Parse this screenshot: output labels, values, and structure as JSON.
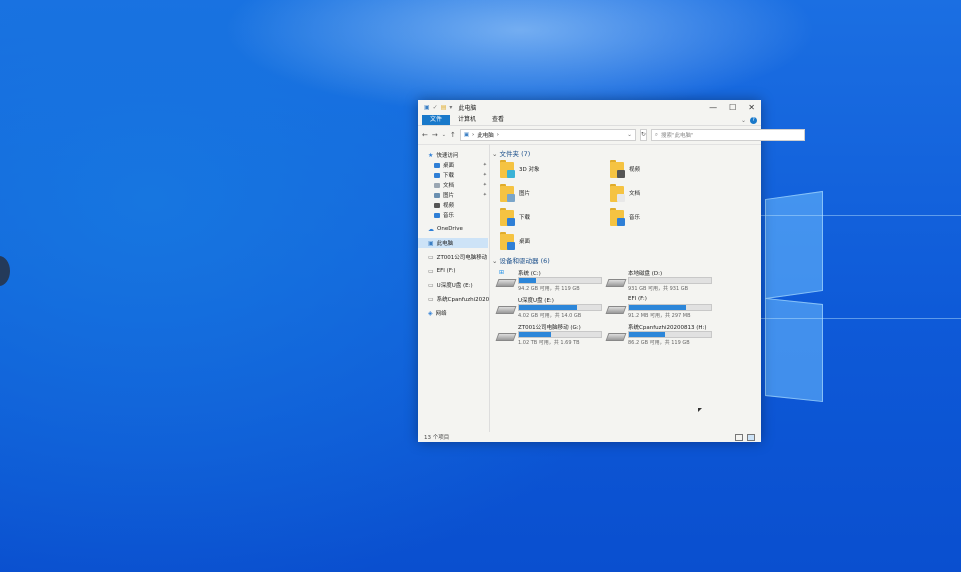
{
  "window": {
    "title": "此电脑",
    "controls": {
      "minimize": "—",
      "maximize": "☐",
      "close": "✕"
    }
  },
  "ribbon": {
    "tabs": [
      "文件",
      "计算机",
      "查看"
    ]
  },
  "address": {
    "path": "此电脑",
    "search_placeholder": "搜索\"此电脑\""
  },
  "sidebar": {
    "quick_access": "快速访问",
    "quick_items": [
      {
        "label": "桌面",
        "pinned": true,
        "color": "#2f7fd6"
      },
      {
        "label": "下载",
        "pinned": true,
        "color": "#2f7fd6"
      },
      {
        "label": "文档",
        "pinned": true,
        "color": "#9aa6b2"
      },
      {
        "label": "图片",
        "pinned": true,
        "color": "#6a8fb0"
      },
      {
        "label": "视频",
        "pinned": false,
        "color": "#555555"
      },
      {
        "label": "音乐",
        "pinned": false,
        "color": "#2f7fd6"
      }
    ],
    "onedrive": "OneDrive",
    "this_pc": "此电脑",
    "drives": [
      "ZT001公司电脑移动",
      "EFI (F:)",
      "U深度U盘 (E:)",
      "系统Cpanfuzhi2020"
    ],
    "network": "网络"
  },
  "folders_section": {
    "header": "文件夹 (7)"
  },
  "folders": [
    {
      "label": "3D 对象",
      "glyph": "#3bb3d6"
    },
    {
      "label": "视频",
      "glyph": "#555555"
    },
    {
      "label": "图片",
      "glyph": "#7aa5c9"
    },
    {
      "label": "文档",
      "glyph": "#e8e8e8"
    },
    {
      "label": "下载",
      "glyph": "#2f7fd6"
    },
    {
      "label": "音乐",
      "glyph": "#2f7fd6"
    },
    {
      "label": "桌面",
      "glyph": "#2f7fd6"
    }
  ],
  "drives_section": {
    "header": "设备和驱动器 (6)"
  },
  "drives": [
    {
      "name": "系统 (C:)",
      "free": "94.2 GB 可用，共 119 GB",
      "used_fraction": 0.21,
      "system": true
    },
    {
      "name": "本地磁盘 (D:)",
      "free": "931 GB 可用，共 931 GB",
      "used_fraction": 0.0,
      "system": false
    },
    {
      "name": "U深度U盘 (E:)",
      "free": "4.02 GB 可用，共 14.0 GB",
      "used_fraction": 0.71,
      "system": false
    },
    {
      "name": "EFI (F:)",
      "free": "91.2 MB 可用，共 297 MB",
      "used_fraction": 0.69,
      "system": false
    },
    {
      "name": "ZT001公司电脑移动 (G:)",
      "free": "1.02 TB 可用，共 1.69 TB",
      "used_fraction": 0.39,
      "system": false
    },
    {
      "name": "系统Cpanfuzhi20200813 (H:)",
      "free": "86.2 GB 可用，共 119 GB",
      "used_fraction": 0.44,
      "system": false
    }
  ],
  "status": {
    "count": "13 个项目"
  },
  "colors": {
    "accent": "#1979ca",
    "bar": "#2c86d9",
    "folder": "#f5c342"
  }
}
